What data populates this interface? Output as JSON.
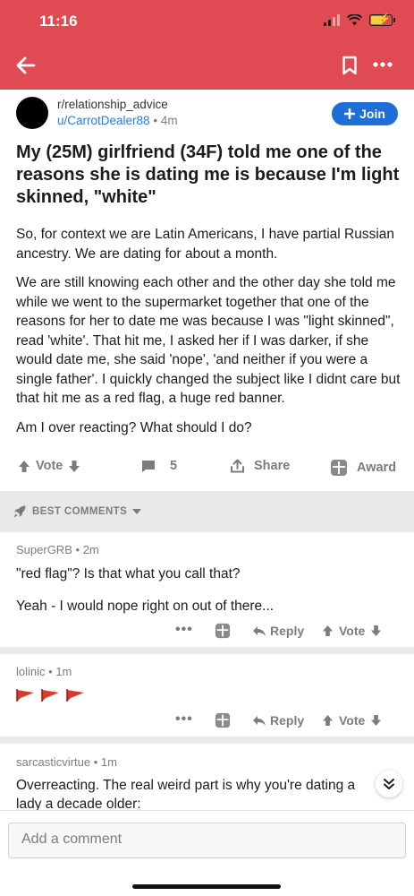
{
  "status_bar": {
    "time": "11:16"
  },
  "post": {
    "subreddit": "r/relationship_advice",
    "author": "u/CarrotDealer88",
    "separator": "•",
    "age": "4m",
    "join_label": "Join",
    "title": "My (25M) girlfriend (34F) told me one of the reasons she is dating me is because I'm light skinned, \"white\"",
    "paragraphs": [
      "So, for context we are Latin Americans, I have partial Russian ancestry. We are dating for about a month.",
      "We are still knowing each other and the other day she told me while we went to the supermarket together that one of the reasons for her to date me was because I was \"light skinned\", read 'white'. That hit me, I asked her if I was darker, if she would date me, she said 'nope', 'and neither if you were a single father'. I quickly changed the subject like I didnt care but that hit me as a red flag, a huge red banner.",
      "Am I over reacting? What should I do?"
    ],
    "actions": {
      "vote_label": "Vote",
      "comments_count": "5",
      "share_label": "Share",
      "award_label": "Award"
    }
  },
  "comments_section": {
    "sort_label": "BEST COMMENTS"
  },
  "comments": [
    {
      "author": "SuperGRB",
      "age": "2m",
      "lines": [
        "\"red flag\"?  Is that what you call that?",
        "Yeah - I would nope right on out of there..."
      ],
      "reply_label": "Reply",
      "vote_label": "Vote"
    },
    {
      "author": "lolinic",
      "age": "1m",
      "flag_count": 3,
      "reply_label": "Reply",
      "vote_label": "Vote"
    },
    {
      "author": "sarcasticvirtue",
      "age": "1m",
      "text": "Overreacting. The real weird part is why you're dating a lady a decade older:"
    }
  ],
  "composer": {
    "placeholder": "Add a comment"
  },
  "colors": {
    "header": "#e04b53",
    "join": "#1f6ed6",
    "link": "#2a7ad6",
    "muted": "#7c7c7c",
    "flag": "#d93a2b"
  }
}
